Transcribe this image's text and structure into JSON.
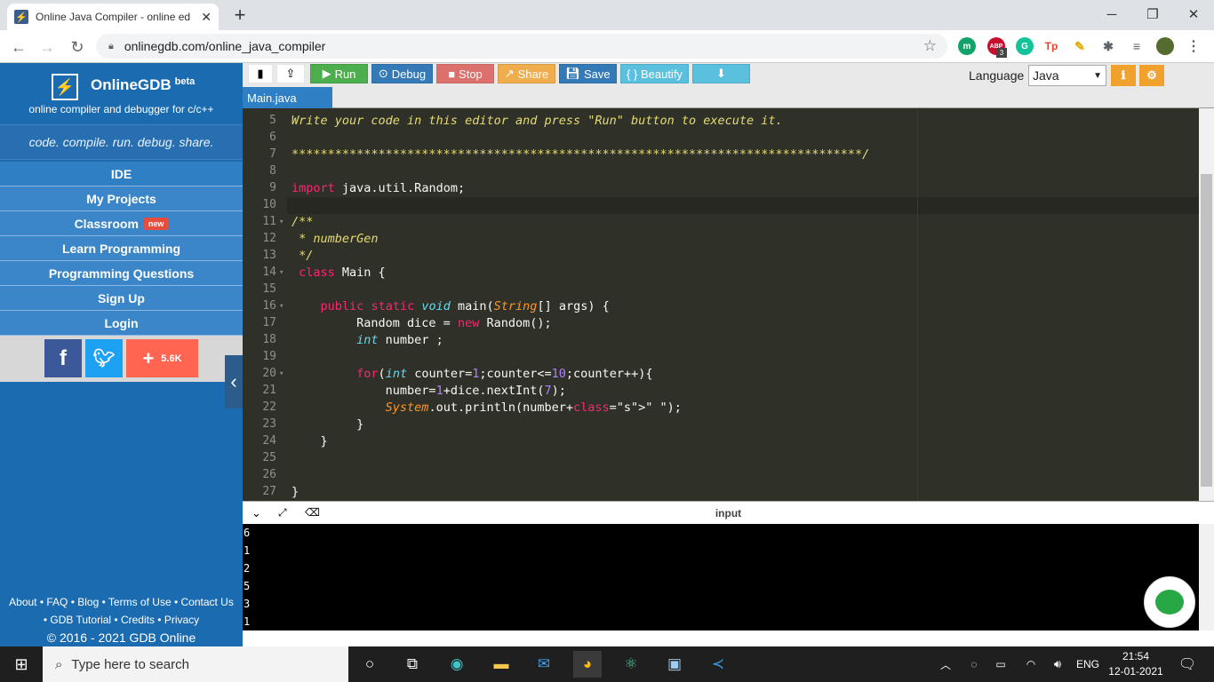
{
  "browser": {
    "tab_title": "Online Java Compiler - online ed",
    "url": "onlinegdb.com/online_java_compiler",
    "extensions": [
      "m",
      "ABP",
      "G",
      "Tp"
    ],
    "abp_badge": "3"
  },
  "sidebar": {
    "brand": "OnlineGDB",
    "beta": "beta",
    "subtitle": "online compiler and debugger for c/c++",
    "tagline": "code. compile. run. debug. share.",
    "menu": [
      {
        "label": "IDE"
      },
      {
        "label": "My Projects"
      },
      {
        "label": "Classroom",
        "badge": "new"
      },
      {
        "label": "Learn Programming"
      },
      {
        "label": "Programming Questions"
      },
      {
        "label": "Sign Up"
      },
      {
        "label": "Login"
      }
    ],
    "share_count": "5.6K",
    "footer_line1": "About • FAQ • Blog • Terms of Use • Contact Us",
    "footer_line2": "• GDB Tutorial • Credits • Privacy",
    "copyright": "© 2016 - 2021 GDB Online"
  },
  "toolbar": {
    "run": "Run",
    "debug": "Debug",
    "stop": "Stop",
    "share": "Share",
    "save": "Save",
    "beautify": "{ } Beautify",
    "language_label": "Language",
    "language_value": "Java"
  },
  "file_tab": "Main.java",
  "editor": {
    "lines": [
      {
        "n": "5",
        "code": "Write your code in this editor and press \"Run\" button to execute it."
      },
      {
        "n": "6",
        "code": ""
      },
      {
        "n": "7",
        "code": "*******************************************************************************/"
      },
      {
        "n": "8",
        "code": ""
      },
      {
        "n": "9",
        "code": "import java.util.Random;"
      },
      {
        "n": "10",
        "code": ""
      },
      {
        "n": "11",
        "code": "/**"
      },
      {
        "n": "12",
        "code": " * numberGen"
      },
      {
        "n": "13",
        "code": " */"
      },
      {
        "n": "14",
        "code": " class Main {"
      },
      {
        "n": "15",
        "code": ""
      },
      {
        "n": "16",
        "code": "    public static void main(String[] args) {"
      },
      {
        "n": "17",
        "code": "         Random dice = new Random();"
      },
      {
        "n": "18",
        "code": "         int number ;"
      },
      {
        "n": "19",
        "code": ""
      },
      {
        "n": "20",
        "code": "         for(int counter=1;counter<=10;counter++){"
      },
      {
        "n": "21",
        "code": "             number=1+dice.nextInt(7);"
      },
      {
        "n": "22",
        "code": "             System.out.println(number+\" \");"
      },
      {
        "n": "23",
        "code": "         }"
      },
      {
        "n": "24",
        "code": "    }"
      },
      {
        "n": "25",
        "code": ""
      },
      {
        "n": "26",
        "code": ""
      },
      {
        "n": "27",
        "code": "}"
      }
    ]
  },
  "console": {
    "label": "input",
    "output": [
      "6",
      "1",
      "2",
      "5",
      "3",
      "1"
    ]
  },
  "taskbar": {
    "search_placeholder": "Type here to search",
    "lang": "ENG",
    "time": "21:54",
    "date": "12-01-2021"
  }
}
